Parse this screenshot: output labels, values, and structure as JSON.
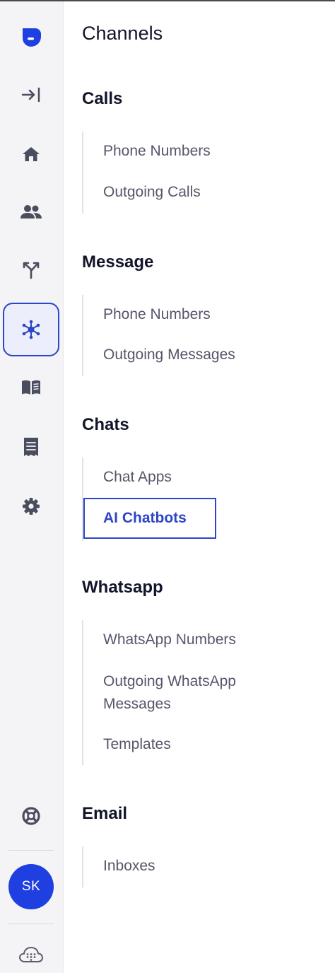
{
  "rail": {
    "items": [
      {
        "icon": "logo-icon"
      },
      {
        "icon": "expand-sidebar-icon"
      },
      {
        "icon": "home-icon"
      },
      {
        "icon": "contacts-icon"
      },
      {
        "icon": "routing-icon"
      },
      {
        "icon": "channels-hub-icon",
        "active": true
      },
      {
        "icon": "knowledge-book-icon"
      },
      {
        "icon": "billing-receipt-icon"
      },
      {
        "icon": "settings-gear-icon"
      },
      {
        "icon": "help-lifebuoy-icon"
      }
    ],
    "avatar_initials": "SK",
    "accent": "#2d45c7",
    "avatar_color": "#1f3fe0"
  },
  "panel": {
    "title": "Channels",
    "sections": [
      {
        "title": "Calls",
        "items": [
          {
            "label": "Phone Numbers"
          },
          {
            "label": "Outgoing Calls"
          }
        ]
      },
      {
        "title": "Message",
        "items": [
          {
            "label": "Phone Numbers"
          },
          {
            "label": "Outgoing Messages"
          }
        ]
      },
      {
        "title": "Chats",
        "items": [
          {
            "label": "Chat Apps"
          },
          {
            "label": "AI Chatbots",
            "active": true
          }
        ]
      },
      {
        "title": "Whatsapp",
        "items": [
          {
            "label": "WhatsApp Numbers"
          },
          {
            "label": "Outgoing WhatsApp Messages",
            "line1": "Outgoing WhatsApp",
            "line2": "Messages"
          },
          {
            "label": "Templates"
          }
        ]
      },
      {
        "title": "Email",
        "items": [
          {
            "label": "Inboxes"
          }
        ]
      }
    ]
  }
}
